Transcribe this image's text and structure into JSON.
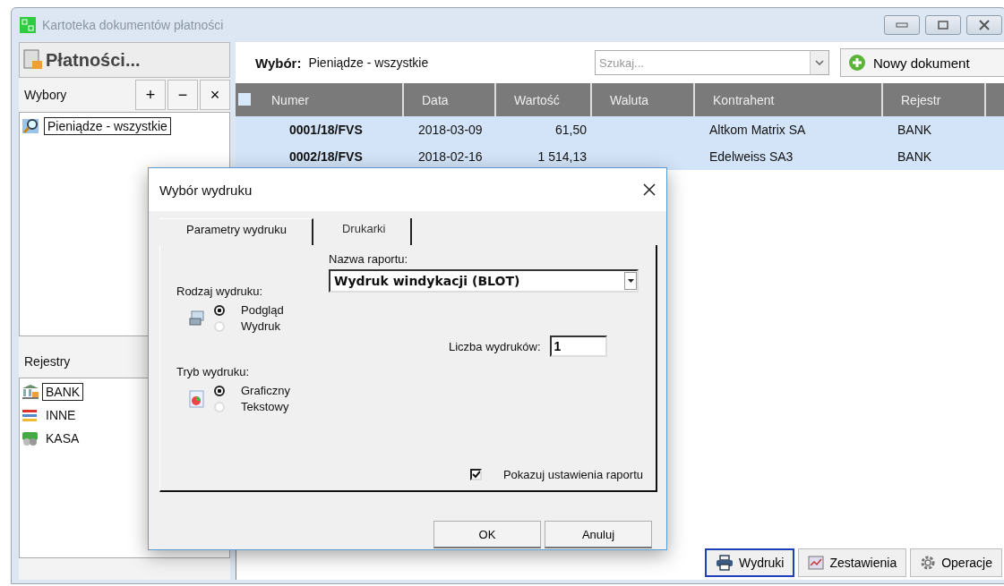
{
  "window": {
    "title": "Kartoteka dokumentów płatności"
  },
  "sidebar": {
    "title": "Płatności...",
    "selections": {
      "label": "Wybory",
      "buttons": [
        "+",
        "−",
        "×"
      ],
      "items": [
        {
          "label": "Pieniądze - wszystkie",
          "selected": true
        }
      ]
    },
    "registers": {
      "label": "Rejestry",
      "items": [
        {
          "label": "BANK",
          "kind": "bank",
          "selected": true
        },
        {
          "label": "INNE",
          "kind": "other",
          "selected": false
        },
        {
          "label": "KASA",
          "kind": "cash",
          "selected": false
        }
      ]
    }
  },
  "main": {
    "selection_label": "Wybór:",
    "selection_value": "Pieniądze - wszystkie",
    "search": {
      "placeholder": "Szukaj..."
    },
    "new_button": "Nowy dokument",
    "table": {
      "select_all_checked": false,
      "columns": [
        "Numer",
        "Data",
        "Wartość",
        "Waluta",
        "Kontrahent",
        "Rejestr"
      ],
      "rows": [
        {
          "selected": true,
          "cells": [
            "0001/18/FVS",
            "2018-03-09",
            "61,50",
            "",
            "Altkom Matrix SA",
            "BANK"
          ]
        },
        {
          "selected": true,
          "cells": [
            "0002/18/FVS",
            "2018-02-16",
            "1 514,13",
            "",
            "Edelweiss SA3",
            "BANK"
          ]
        }
      ]
    },
    "bottom_buttons": [
      {
        "label": "Wydruki",
        "kind": "printer",
        "selected": true
      },
      {
        "label": "Zestawienia",
        "kind": "chart",
        "selected": false
      },
      {
        "label": "Operacje",
        "kind": "gear",
        "selected": false
      }
    ]
  },
  "dialog": {
    "title": "Wybór wydruku",
    "tabs": [
      {
        "label": "Parametry wydruku",
        "selected": true
      },
      {
        "label": "Drukarki",
        "selected": false
      }
    ],
    "report_label": "Nazwa raportu:",
    "report_value": "Wydruk windykacji (BLOT)",
    "print_type_label": "Rodzaj wydruku:",
    "print_type_options": [
      {
        "label": "Podgląd",
        "selected": true
      },
      {
        "label": "Wydruk",
        "selected": false
      }
    ],
    "copies_label": "Liczba wydruków:",
    "copies_value": "1",
    "mode_label": "Tryb wydruku:",
    "mode_options": [
      {
        "label": "Graficzny",
        "selected": true
      },
      {
        "label": "Tekstowy",
        "selected": false
      }
    ],
    "show_settings": {
      "label": "Pokazuj ustawienia raportu",
      "checked": true
    },
    "buttons": [
      "OK",
      "Anuluj"
    ]
  }
}
